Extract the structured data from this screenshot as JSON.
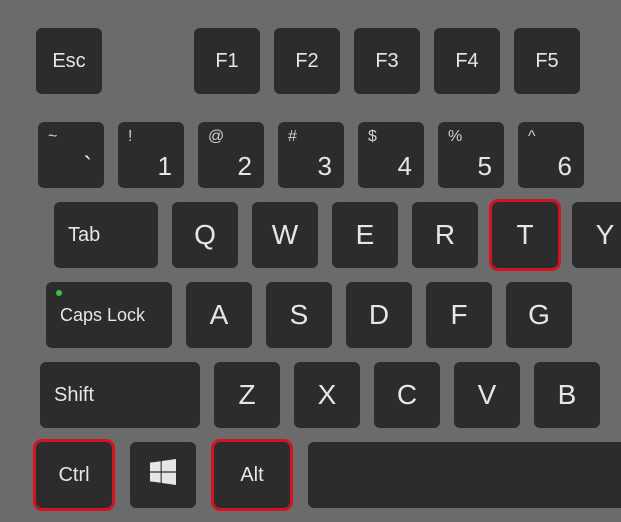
{
  "row_fn": {
    "esc": "Esc",
    "keys": [
      "F1",
      "F2",
      "F3",
      "F4",
      "F5"
    ]
  },
  "row_num": [
    {
      "top": "~",
      "main": "`"
    },
    {
      "top": "!",
      "main": "1"
    },
    {
      "top": "@",
      "main": "2"
    },
    {
      "top": "#",
      "main": "3"
    },
    {
      "top": "$",
      "main": "4"
    },
    {
      "top": "%",
      "main": "5"
    },
    {
      "top": "^",
      "main": "6"
    }
  ],
  "row_q": {
    "tab": "Tab",
    "letters": [
      "Q",
      "W",
      "E",
      "R",
      "T",
      "Y"
    ]
  },
  "row_a": {
    "caps": "Caps Lock",
    "letters": [
      "A",
      "S",
      "D",
      "F",
      "G"
    ]
  },
  "row_z": {
    "shift": "Shift",
    "letters": [
      "Z",
      "X",
      "C",
      "V",
      "B"
    ]
  },
  "row_mod": {
    "ctrl": "Ctrl",
    "alt": "Alt"
  },
  "highlights": {
    "t": true,
    "ctrl": true,
    "alt": true
  }
}
